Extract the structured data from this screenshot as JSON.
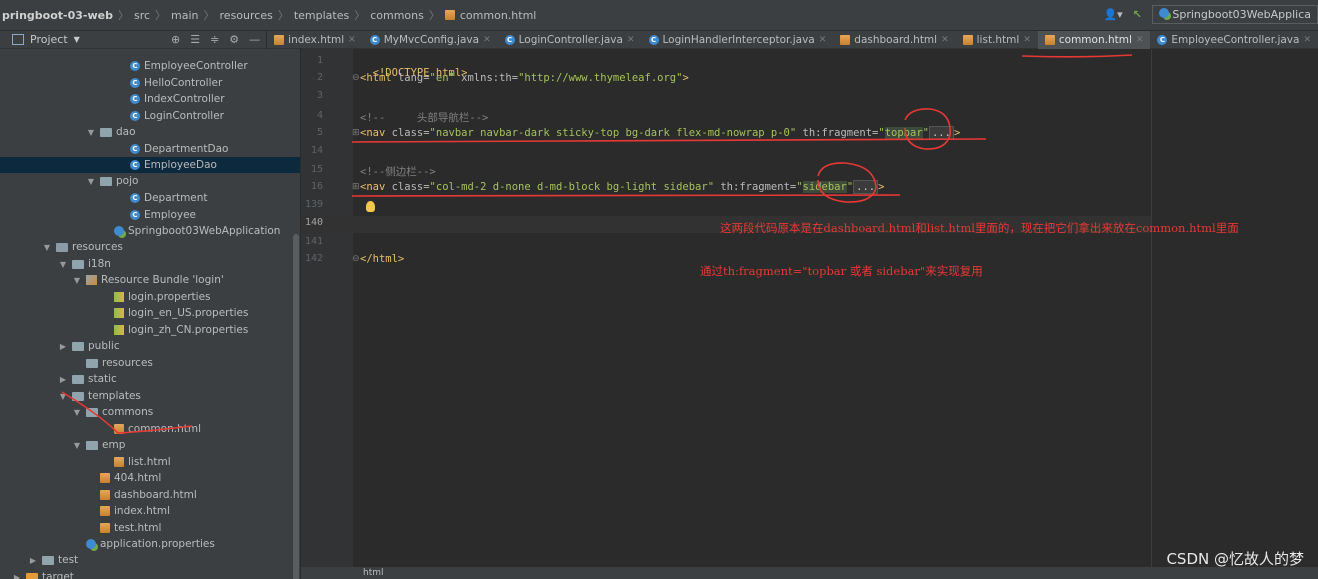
{
  "breadcrumb": {
    "project": "pringboot-03-web",
    "items": [
      "src",
      "main",
      "resources",
      "templates",
      "commons"
    ],
    "file": "common.html"
  },
  "run_config": "Springboot03WebApplica",
  "project_panel": {
    "title": "Project"
  },
  "tabs": [
    {
      "label": "index.html",
      "icon": "html-file-icon"
    },
    {
      "label": "MyMvcConfig.java",
      "icon": "class-icon"
    },
    {
      "label": "LoginController.java",
      "icon": "class-icon"
    },
    {
      "label": "LoginHandlerInterceptor.java",
      "icon": "class-icon"
    },
    {
      "label": "dashboard.html",
      "icon": "html-file-icon"
    },
    {
      "label": "list.html",
      "icon": "html-file-icon"
    },
    {
      "label": "common.html",
      "icon": "html-file-icon",
      "active": true
    },
    {
      "label": "EmployeeController.java",
      "icon": "class-icon"
    }
  ],
  "tree": [
    {
      "label": "EmployeeController",
      "icon": "class"
    },
    {
      "label": "HelloController",
      "icon": "class"
    },
    {
      "label": "IndexController",
      "icon": "class"
    },
    {
      "label": "LoginController",
      "icon": "class"
    },
    {
      "label": "dao",
      "icon": "folder",
      "arrow": "down"
    },
    {
      "label": "DepartmentDao",
      "icon": "class"
    },
    {
      "label": "EmployeeDao",
      "icon": "class",
      "selected": true
    },
    {
      "label": "pojo",
      "icon": "folder",
      "arrow": "down"
    },
    {
      "label": "Department",
      "icon": "class"
    },
    {
      "label": "Employee",
      "icon": "class"
    },
    {
      "label": "Springboot03WebApplication",
      "icon": "app"
    },
    {
      "label": "resources",
      "icon": "resfolder",
      "arrow": "down"
    },
    {
      "label": "i18n",
      "icon": "folder",
      "arrow": "down"
    },
    {
      "label": "Resource Bundle 'login'",
      "icon": "bundle",
      "arrow": "down"
    },
    {
      "label": "login.properties",
      "icon": "props"
    },
    {
      "label": "login_en_US.properties",
      "icon": "props"
    },
    {
      "label": "login_zh_CN.properties",
      "icon": "props"
    },
    {
      "label": "public",
      "icon": "folder",
      "arrow": "right"
    },
    {
      "label": "resources",
      "icon": "folder"
    },
    {
      "label": "static",
      "icon": "folder",
      "arrow": "right"
    },
    {
      "label": "templates",
      "icon": "folder",
      "arrow": "down"
    },
    {
      "label": "commons",
      "icon": "folder",
      "arrow": "down"
    },
    {
      "label": "common.html",
      "icon": "html"
    },
    {
      "label": "emp",
      "icon": "folder",
      "arrow": "down"
    },
    {
      "label": "list.html",
      "icon": "html"
    },
    {
      "label": "404.html",
      "icon": "html"
    },
    {
      "label": "dashboard.html",
      "icon": "html"
    },
    {
      "label": "index.html",
      "icon": "html"
    },
    {
      "label": "test.html",
      "icon": "html"
    },
    {
      "label": "application.properties",
      "icon": "appprops"
    },
    {
      "label": "test",
      "icon": "folder",
      "arrow": "right"
    },
    {
      "label": "target",
      "icon": "targetfolder",
      "arrow": "right"
    }
  ],
  "editor": {
    "line_numbers": [
      "1",
      "2",
      "3",
      "4",
      "5",
      "14",
      "15",
      "16",
      "139",
      "140",
      "141",
      "142"
    ],
    "lines": {
      "l1": "<!DOCTYPE html>",
      "l2_tag": "<html ",
      "l2_attr1": "lang=",
      "l2_val1": "\"en\"",
      "l2_attr2": " xmlns:th=",
      "l2_val2": "\"http://www.thymeleaf.org\"",
      "l2_end": ">",
      "l4": "<!--     头部导航栏-->",
      "l5_tag": "<nav ",
      "l5_attr1": "class=",
      "l5_val1": "\"navbar navbar-dark sticky-top bg-dark flex-md-nowrap p-0\"",
      "l5_attr2": " th:fragment=",
      "l5_q1": "\"",
      "l5_frag": "topbar",
      "l5_q2": "\"",
      "l5_fold": "...",
      "l5_end": ">",
      "l15": "<!--侧边栏-->",
      "l16_tag": "<nav ",
      "l16_attr1": "class=",
      "l16_val1": "\"col-md-2 d-none d-md-block bg-light sidebar\"",
      "l16_attr2": " th:fragment=",
      "l16_q1": "\"",
      "l16_frag": "sidebar",
      "l16_q2": "\"",
      "l16_fold": "...",
      "l16_end": ">",
      "l142": "</html>"
    }
  },
  "annotations": {
    "note1": "这两段代码原本是在dashboard.html和list.html里面的，现在把它们拿出来放在common.html里面",
    "note2": "通过th:fragment=\"topbar   或者  sidebar\"来实现复用"
  },
  "status_text": "html",
  "watermark": "CSDN @忆故人的梦",
  "colors": {
    "ink": "#e53935",
    "accent": "#3d8bd1"
  }
}
